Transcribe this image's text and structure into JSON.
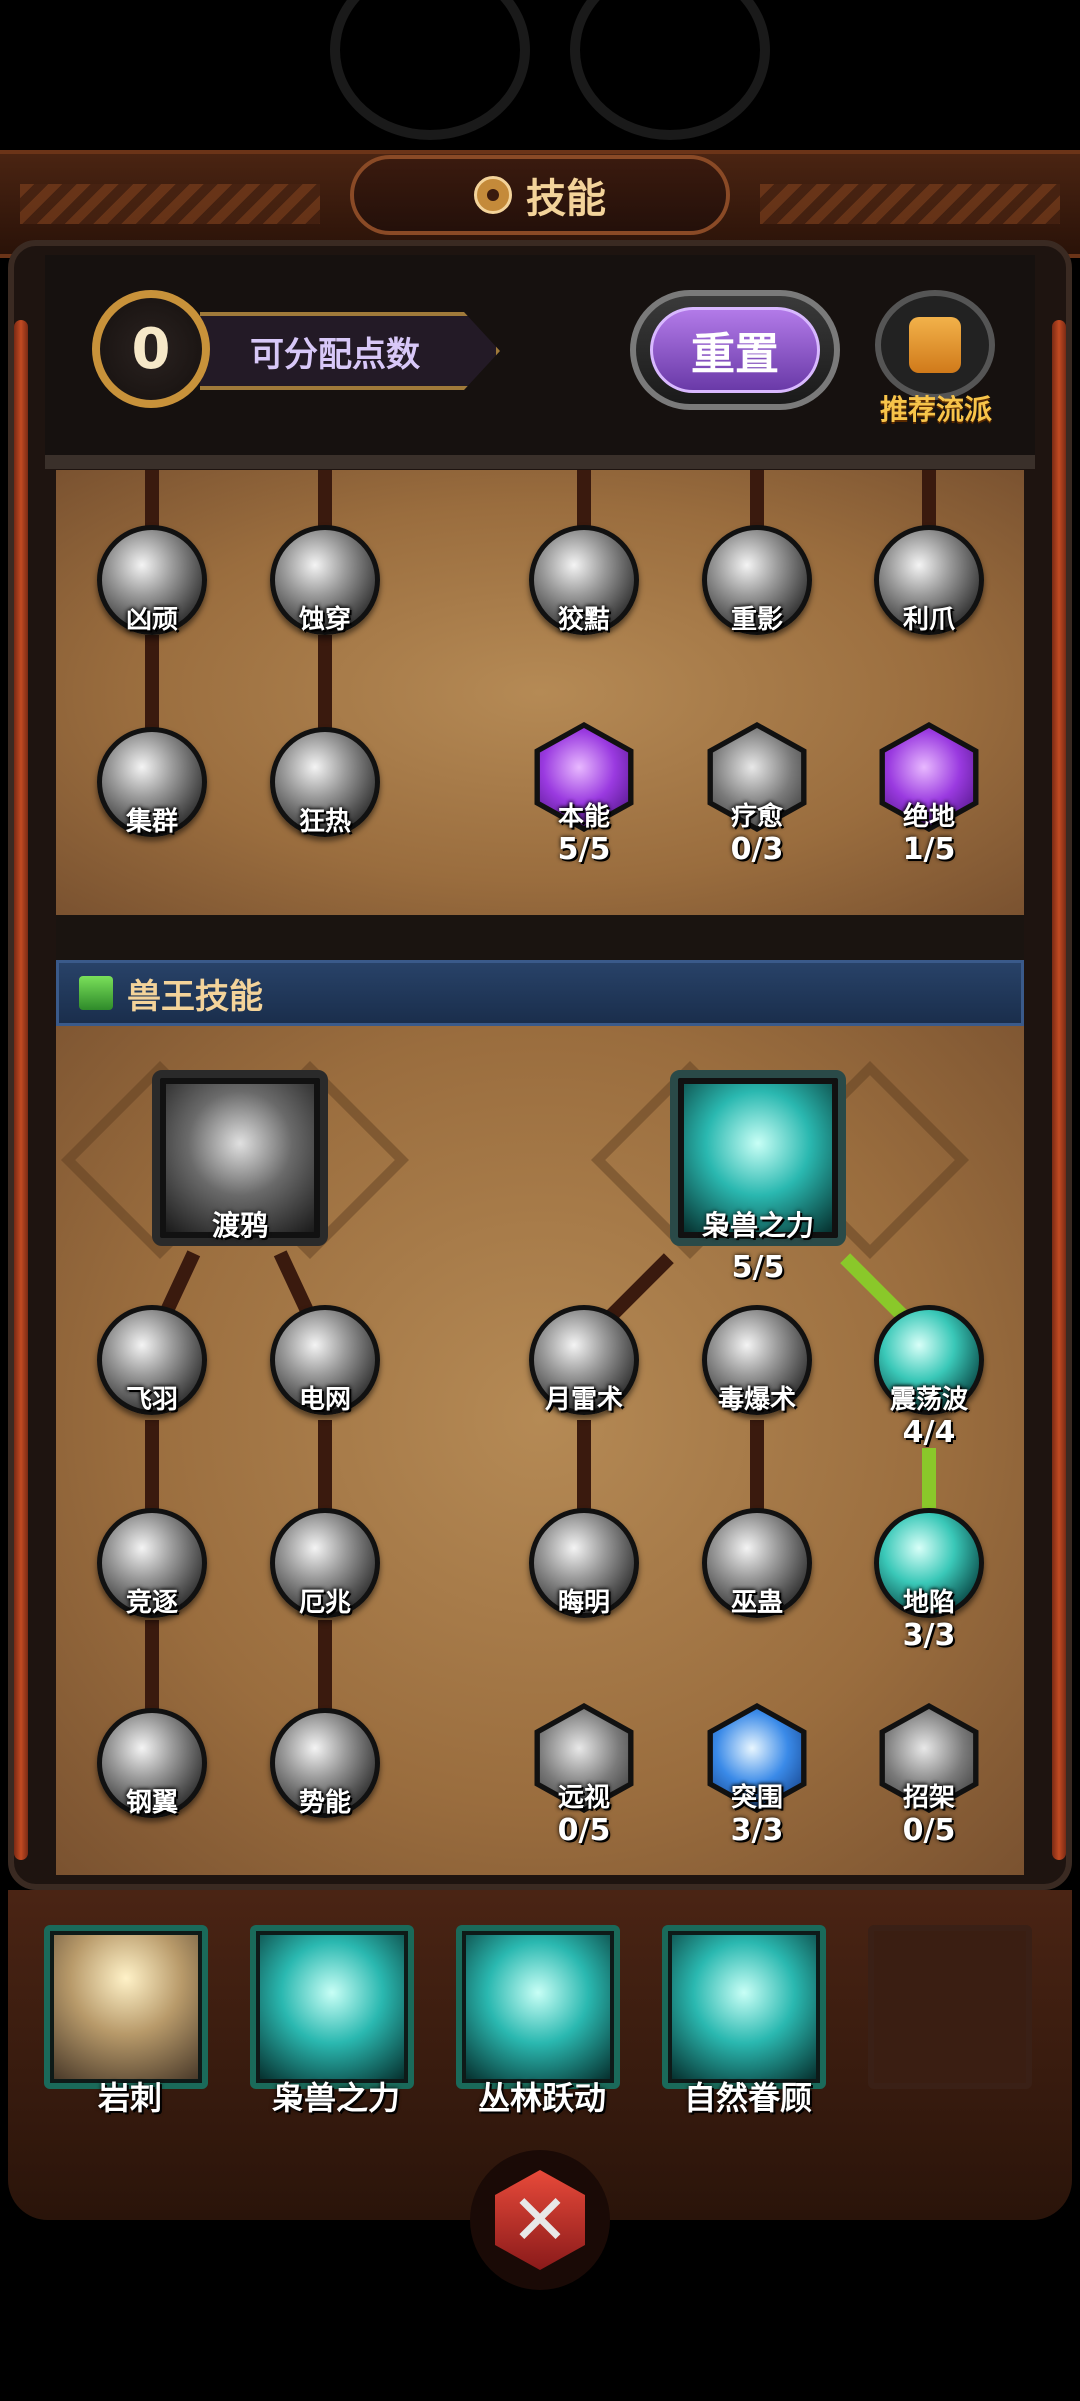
{
  "title": "技能",
  "header": {
    "points": "0",
    "points_label": "可分配点数",
    "reset_label": "重置",
    "recommend_label": "推荐流派"
  },
  "upper_tree": {
    "row1": [
      "凶顽",
      "蚀穿",
      "狡黠",
      "重影",
      "利爪"
    ],
    "row2": [
      {
        "name": "集群"
      },
      {
        "name": "狂热"
      },
      {
        "name": "本能",
        "level": "5/5"
      },
      {
        "name": "疗愈",
        "level": "0/3"
      },
      {
        "name": "绝地",
        "level": "1/5"
      }
    ]
  },
  "beast_section": {
    "title": "兽王技能",
    "root_left": {
      "name": "渡鸦"
    },
    "root_right": {
      "name": "枭兽之力",
      "level": "5/5"
    },
    "row1": [
      {
        "name": "飞羽"
      },
      {
        "name": "电网"
      },
      {
        "name": "月雷术"
      },
      {
        "name": "毒爆术"
      },
      {
        "name": "震荡波",
        "level": "4/4"
      }
    ],
    "row2": [
      {
        "name": "竞逐"
      },
      {
        "name": "厄兆"
      },
      {
        "name": "晦明"
      },
      {
        "name": "巫蛊"
      },
      {
        "name": "地陷",
        "level": "3/3"
      }
    ],
    "row3": [
      {
        "name": "钢翼"
      },
      {
        "name": "势能"
      },
      {
        "name": "远视",
        "level": "0/5"
      },
      {
        "name": "突围",
        "level": "3/3"
      },
      {
        "name": "招架",
        "level": "0/5"
      }
    ]
  },
  "equipped": [
    "岩刺",
    "枭兽之力",
    "丛林跃动",
    "自然眷顾"
  ],
  "icons": {
    "title": "wheel-icon",
    "recommend": "thumbs-up-icon",
    "section": "boot-icon",
    "close": "close-icon"
  },
  "colors": {
    "reset": "#8a4ad0",
    "active_path": "#8ac82a",
    "section_bg": "#1e3658",
    "wood": "#a87a48"
  }
}
